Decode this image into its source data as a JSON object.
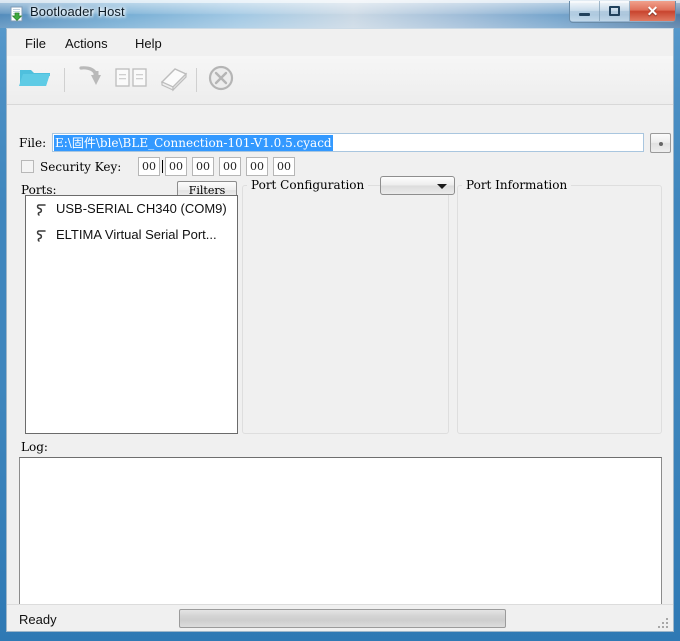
{
  "window": {
    "title": "Bootloader Host",
    "icon": "bootloader-document-download-icon",
    "buttons": {
      "minimize": "minimize-icon",
      "maximize": "maximize-icon",
      "close": "✕"
    }
  },
  "menubar": {
    "items": [
      {
        "label": "File"
      },
      {
        "label": "Actions"
      },
      {
        "label": "Help"
      }
    ]
  },
  "toolbar": {
    "buttons": [
      {
        "name": "open-file-button",
        "icon": "open-folder-icon",
        "enabled": true
      },
      {
        "name": "program-button",
        "icon": "download-arrow-icon",
        "enabled": false
      },
      {
        "name": "verify-button",
        "icon": "two-documents-icon",
        "enabled": false
      },
      {
        "name": "erase-button",
        "icon": "eraser-icon",
        "enabled": false
      },
      {
        "name": "abort-button",
        "icon": "circle-x-icon",
        "enabled": false
      }
    ]
  },
  "file_row": {
    "label": "File:",
    "value": "E:\\固件\\ble\\BLE_Connection-101-V1.0.5.cyacd",
    "selected": true,
    "browse_label": ""
  },
  "security_key": {
    "label": "Security Key:",
    "checked": false,
    "bytes": [
      "00",
      "00",
      "00",
      "00",
      "00",
      "00"
    ]
  },
  "ports": {
    "label": "Ports:",
    "filters_button": "Filters",
    "items": [
      {
        "label": "USB-SERIAL CH340 (COM9)",
        "icon": "serial-port-icon"
      },
      {
        "label": "ELTIMA Virtual Serial Port...",
        "icon": "serial-port-icon"
      }
    ]
  },
  "port_configuration": {
    "title": "Port Configuration",
    "dropdown_value": ""
  },
  "port_information": {
    "title": "Port Information",
    "content": ""
  },
  "log": {
    "label": "Log:",
    "content": ""
  },
  "statusbar": {
    "status": "Ready",
    "progress_percent": 0,
    "grip": "resize-grip-icon"
  },
  "colors": {
    "selection_blue": "#3399ff",
    "accent_cyan": "#4fc0dd",
    "frame_blue": "#3f86bd",
    "close_red": "#c8442e"
  }
}
